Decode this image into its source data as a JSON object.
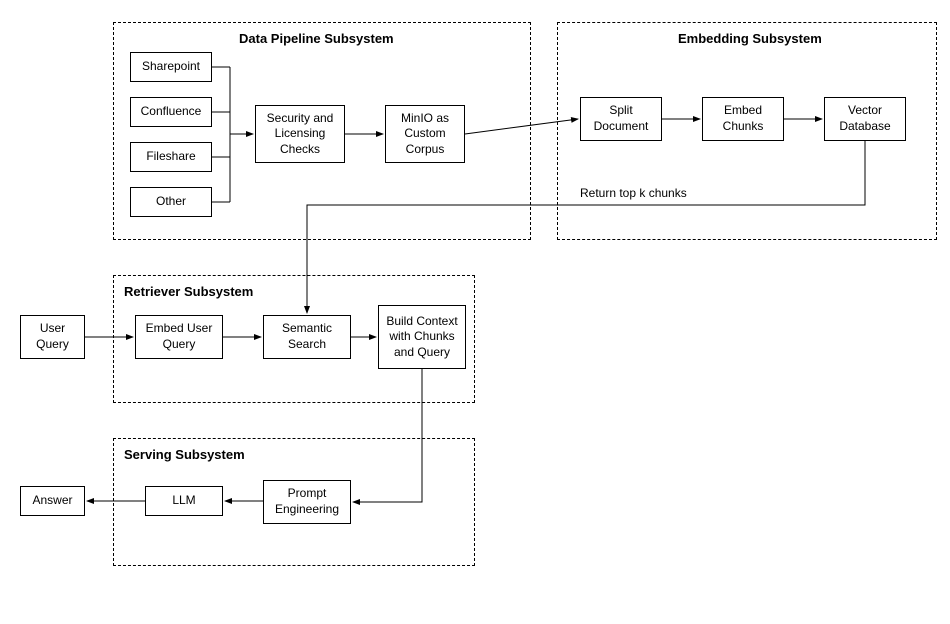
{
  "subsystems": {
    "dataPipeline": {
      "title": "Data Pipeline Subsystem"
    },
    "embedding": {
      "title": "Embedding Subsystem"
    },
    "retriever": {
      "title": "Retriever Subsystem"
    },
    "serving": {
      "title": "Serving Subsystem"
    }
  },
  "boxes": {
    "sharepoint": "Sharepoint",
    "confluence": "Confluence",
    "fileshare": "Fileshare",
    "other": "Other",
    "security": "Security and Licensing Checks",
    "minio": "MinIO as Custom Corpus",
    "splitDoc": "Split Document",
    "embedChunks": "Embed Chunks",
    "vectorDb": "Vector Database",
    "userQuery": "User Query",
    "embedUserQuery": "Embed User Query",
    "semanticSearch": "Semantic Search",
    "buildContext": "Build Context with Chunks and Query",
    "answer": "Answer",
    "llm": "LLM",
    "promptEng": "Prompt Engineering"
  },
  "labels": {
    "returnTopK": "Return top k chunks"
  }
}
